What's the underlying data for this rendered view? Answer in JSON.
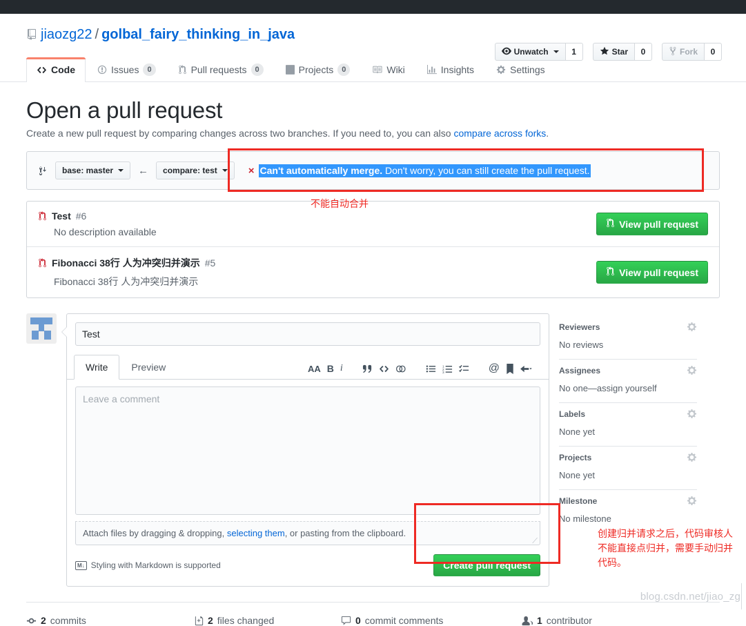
{
  "repo": {
    "owner": "jiaozg22",
    "separator": "/",
    "name": "golbal_fairy_thinking_in_java",
    "book_icon": "repo-icon"
  },
  "repo_actions": [
    {
      "label": "Unwatch",
      "count": "1",
      "icon": "eye-icon",
      "disabled": false,
      "has_caret": true
    },
    {
      "label": "Star",
      "count": "0",
      "icon": "star-icon",
      "disabled": false,
      "has_caret": false
    },
    {
      "label": "Fork",
      "count": "0",
      "icon": "fork-icon",
      "disabled": true,
      "has_caret": false
    }
  ],
  "nav_tabs": [
    {
      "label": "Code",
      "icon": "code-icon",
      "count": null,
      "selected": true
    },
    {
      "label": "Issues",
      "icon": "issue-opened-icon",
      "count": "0",
      "selected": false
    },
    {
      "label": "Pull requests",
      "icon": "git-pull-request-icon",
      "count": "0",
      "selected": false
    },
    {
      "label": "Projects",
      "icon": "project-board-icon",
      "count": "0",
      "selected": false
    },
    {
      "label": "Wiki",
      "icon": "book-icon",
      "count": null,
      "selected": false
    },
    {
      "label": "Insights",
      "icon": "graph-icon",
      "count": null,
      "selected": false
    },
    {
      "label": "Settings",
      "icon": "gear-icon",
      "count": null,
      "selected": false
    }
  ],
  "page": {
    "title": "Open a pull request",
    "subtitle_before": "Create a new pull request by comparing changes across two branches. If you need to, you can also ",
    "subtitle_link": "compare across forks",
    "subtitle_after": "."
  },
  "compare": {
    "branch_icon": "compare-branches-icon",
    "base_label": "base: master",
    "arrow": "←",
    "compare_label": "compare: test",
    "merge_x": "×",
    "merge_warning_bold": "Can't automatically merge.",
    "merge_warning_rest": " Don't worry, you can still create the pull request.",
    "selection_color": "#3297fd"
  },
  "annotations": {
    "cannot_automerge": "不能自动合并",
    "create_pr_note": "创建归并请求之后，代码审核人\n不能直接点归并，需要手动归并\n代码。",
    "box_color": "#ee2a24"
  },
  "existing_prs": [
    {
      "icon": "git-pull-request-icon",
      "title": "Test",
      "number": "#6",
      "description": "No description available",
      "button_label": "View pull request"
    },
    {
      "icon": "git-pull-request-icon",
      "title": "Fibonacci 38行 人为冲突归并演示",
      "number": "#5",
      "description": "Fibonacci 38行 人为冲突归并演示",
      "button_label": "View pull request"
    }
  ],
  "compose": {
    "avatar_name": "user-avatar",
    "title_value": "Test",
    "title_placeholder": "Title",
    "tabs": [
      {
        "label": "Write",
        "active": true
      },
      {
        "label": "Preview",
        "active": false
      }
    ],
    "toolbar": [
      {
        "name": "heading-icon",
        "glyph": "AA"
      },
      {
        "name": "bold-icon",
        "glyph": "B"
      },
      {
        "name": "italic-icon",
        "glyph": "i"
      },
      {
        "name": "quote-icon",
        "glyph": "“"
      },
      {
        "name": "code-icon",
        "glyph": "<>"
      },
      {
        "name": "link-icon",
        "glyph": "⚭"
      },
      {
        "name": "unordered-list-icon",
        "glyph": "☰"
      },
      {
        "name": "ordered-list-icon",
        "glyph": "≡"
      },
      {
        "name": "task-list-icon",
        "glyph": "✓"
      },
      {
        "name": "mention-icon",
        "glyph": "@"
      },
      {
        "name": "reference-icon",
        "glyph": "⚑"
      },
      {
        "name": "reply-icon",
        "glyph": "↩"
      }
    ],
    "comment_placeholder": "Leave a comment",
    "attach_before": "Attach files by dragging & dropping, ",
    "attach_link": "selecting them",
    "attach_after": ", or pasting from the clipboard.",
    "markdown_note": "Styling with Markdown is supported",
    "markdown_logo": "M↓",
    "submit_label": "Create pull request"
  },
  "sidebar": [
    {
      "heading": "Reviewers",
      "value": "No reviews",
      "gear": "gear-icon"
    },
    {
      "heading": "Assignees",
      "value": "No one—assign yourself",
      "gear": "gear-icon"
    },
    {
      "heading": "Labels",
      "value": "None yet",
      "gear": "gear-icon"
    },
    {
      "heading": "Projects",
      "value": "None yet",
      "gear": "gear-icon"
    },
    {
      "heading": "Milestone",
      "value": "No milestone",
      "gear": "gear-icon"
    }
  ],
  "stats": [
    {
      "icon": "commit-icon",
      "count": "2",
      "label": "commits"
    },
    {
      "icon": "file-diff-icon",
      "count": "2",
      "label": "files changed"
    },
    {
      "icon": "comment-icon",
      "count": "0",
      "label": "commit comments"
    },
    {
      "icon": "people-icon",
      "count": "1",
      "label": "contributor"
    }
  ],
  "watermark": "blog.csdn.net/jiao_zg"
}
